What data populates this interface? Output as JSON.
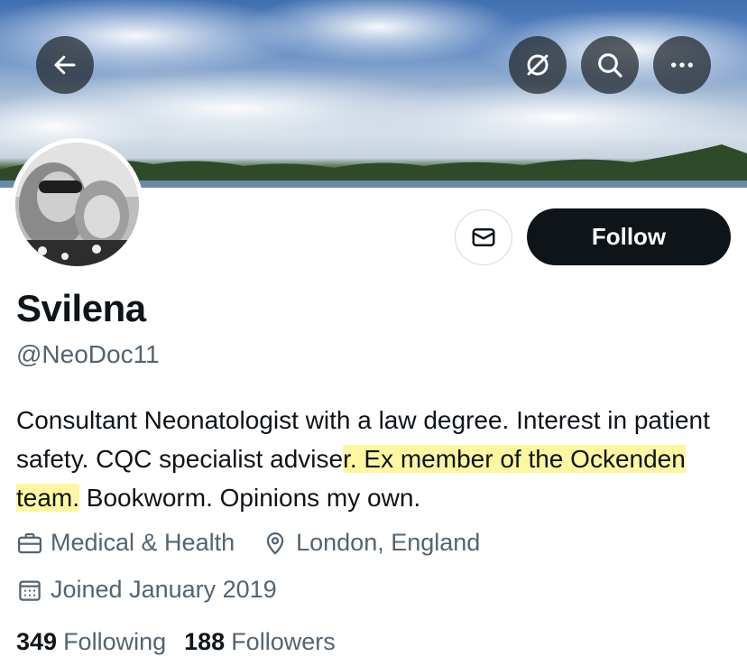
{
  "header": {
    "back_icon": "arrow-left-icon",
    "translate_icon": "slashed-circle-icon",
    "search_icon": "search-icon",
    "more_icon": "more-dots-icon"
  },
  "profile": {
    "display_name": "Svilena",
    "handle": "@NeoDoc11",
    "bio": {
      "part1": "Consultant Neonatologist with a law degree. Interest in patient safety. CQC specialist advise",
      "highlight": "r. Ex member of the Ockenden team.",
      "part2": " Bookworm. Opinions my own."
    },
    "category": "Medical & Health",
    "location": "London, England",
    "joined": "Joined January 2019",
    "following_count": "349",
    "following_label": "Following",
    "followers_count": "188",
    "followers_label": "Followers"
  },
  "actions": {
    "message_icon": "envelope-icon",
    "follow_label": "Follow"
  },
  "colors": {
    "primary_text": "#0f1419",
    "secondary_text": "#536471",
    "highlight": "#fdf7a1",
    "follow_bg": "#0f1419"
  }
}
